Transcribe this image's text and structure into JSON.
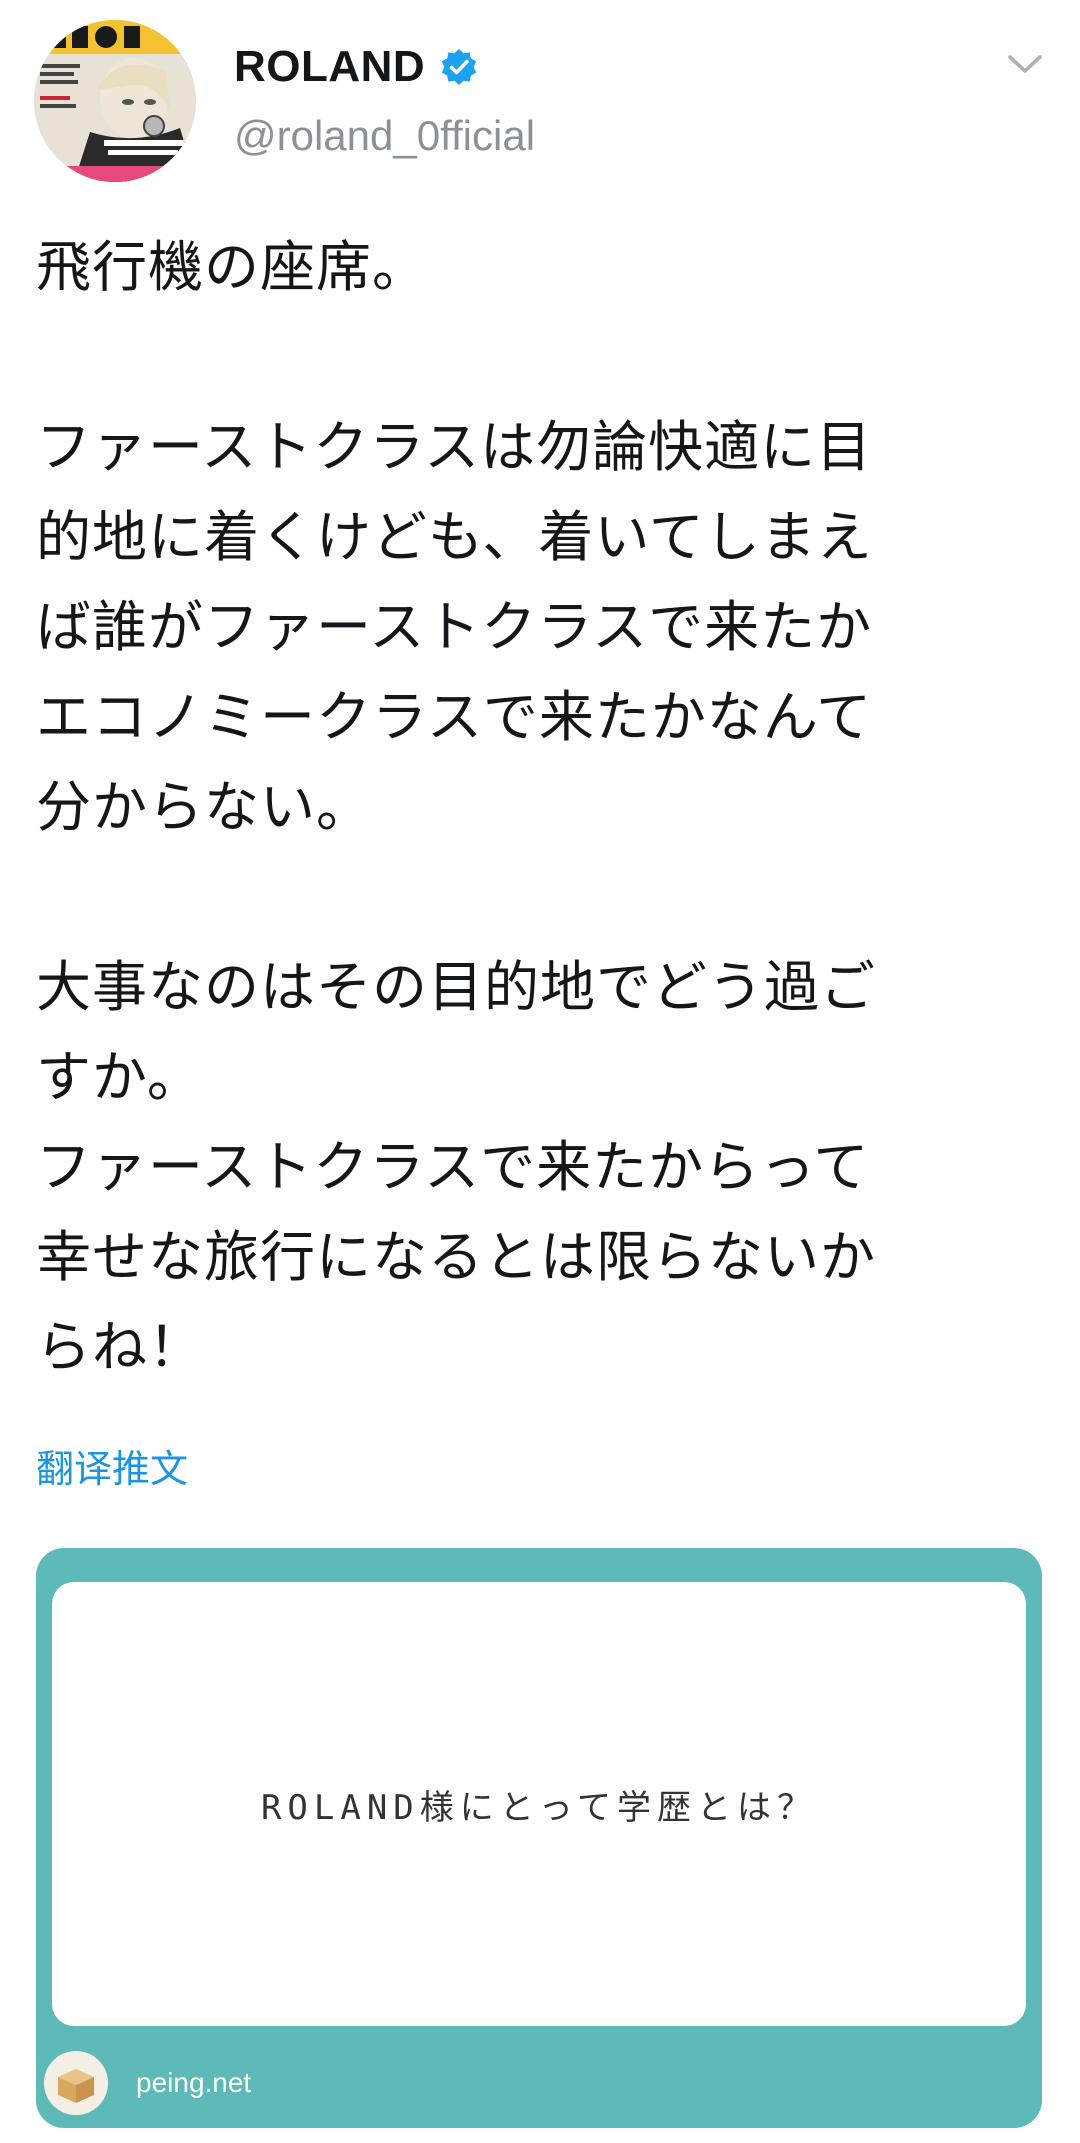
{
  "header": {
    "display_name": "ROLAND",
    "handle": "@roland_0fficial",
    "avatar_icon": "magazine-cover-avatar",
    "verified_icon": "verified-badge-icon",
    "more_icon": "chevron-down-icon"
  },
  "tweet": {
    "lines": [
      "飛行機の座席。",
      "",
      "ファーストクラスは勿論快適に目",
      "的地に着くけども、着いてしまえ",
      "ば誰がファーストクラスで来たか",
      "エコノミークラスで来たかなんて",
      "分からない。",
      "",
      "大事なのはその目的地でどう過ご",
      "すか。",
      "ファーストクラスで来たからって",
      "幸せな旅行になるとは限らないか",
      "らね！"
    ],
    "translate_label": "翻译推文"
  },
  "card": {
    "question": "ROLAND様にとって学歴とは？",
    "domain": "peing.net",
    "logo_icon": "peing-box-icon"
  },
  "colors": {
    "text": "#14171a",
    "secondary": "#8a9199",
    "link": "#1b95e0",
    "verified": "#1da1f2",
    "card_teal": "#5dbab8"
  }
}
